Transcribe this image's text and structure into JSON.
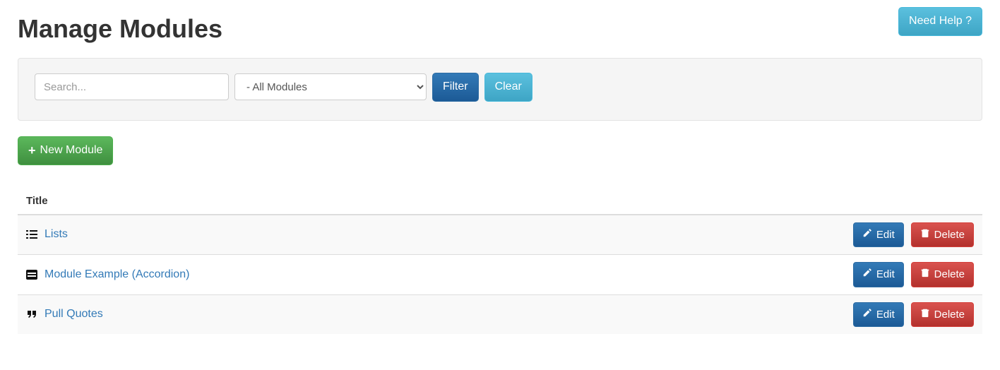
{
  "header": {
    "title": "Manage Modules",
    "need_help_label": "Need Help ?"
  },
  "filter": {
    "search_placeholder": "Search...",
    "select_value": "- All Modules",
    "filter_label": "Filter",
    "clear_label": "Clear"
  },
  "toolbar": {
    "new_module_label": "New Module"
  },
  "table": {
    "header_title": "Title",
    "edit_label": "Edit",
    "delete_label": "Delete",
    "rows": [
      {
        "icon": "list-icon",
        "title": "Lists"
      },
      {
        "icon": "accordion-icon",
        "title": "Module Example (Accordion)"
      },
      {
        "icon": "quote-icon",
        "title": "Pull Quotes"
      }
    ]
  }
}
